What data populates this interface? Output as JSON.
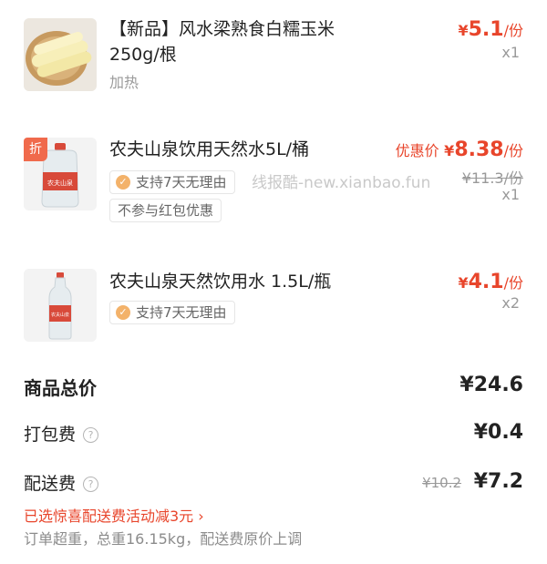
{
  "items": [
    {
      "title": "【新品】风水梁熟食白糯玉米250g/根",
      "option": "加热",
      "price_currency": "¥",
      "price_value": "5.1",
      "price_unit": "/份",
      "quantity": "x1",
      "thumb_icon": "corn-image"
    },
    {
      "badge": "折",
      "title": "农夫山泉饮用天然水5L/桶",
      "price_prefix": "优惠价",
      "price_currency": "¥",
      "price_value": "8.38",
      "price_unit": "/份",
      "original_price": "¥11.3/份",
      "quantity": "x1",
      "tags": [
        "支持7天无理由",
        "不参与红包优惠"
      ],
      "thumb_icon": "water-5l-bottle-image"
    },
    {
      "title": "农夫山泉天然饮用水 1.5L/瓶",
      "price_currency": "¥",
      "price_value": "4.1",
      "price_unit": "/份",
      "quantity": "x2",
      "tags": [
        "支持7天无理由"
      ],
      "thumb_icon": "water-1.5l-bottle-image"
    }
  ],
  "watermark": "线报酷-new.xianbao.fun",
  "summary": {
    "total_label": "商品总价",
    "total_value": "¥24.6",
    "packing_label": "打包费",
    "packing_value": "¥0.4",
    "delivery_label": "配送费",
    "delivery_original": "¥10.2",
    "delivery_value": "¥7.2",
    "delivery_promo": "已选惊喜配送费活动减3元 ",
    "delivery_note": "订单超重，总重16.15kg，配送费原价上调"
  },
  "colors": {
    "accent": "#e8452b",
    "muted": "#9a9a9a",
    "badge": "#f06a4c"
  }
}
